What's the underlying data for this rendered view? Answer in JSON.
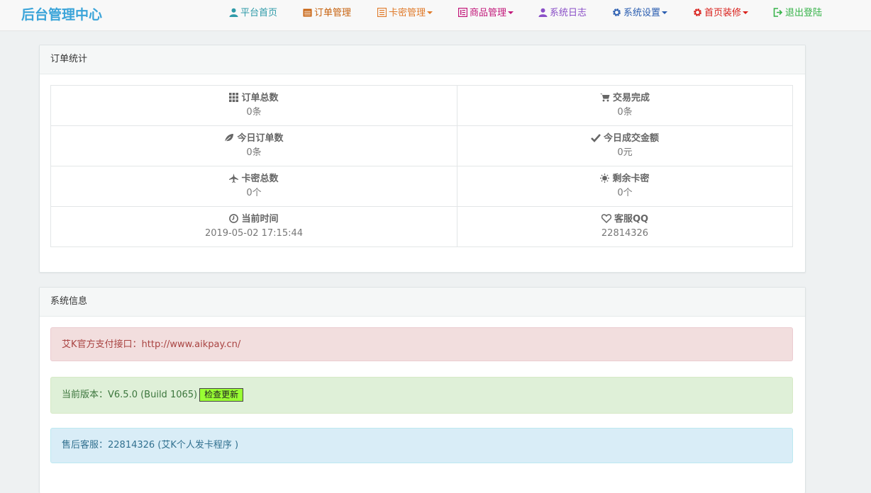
{
  "brand": "后台管理中心",
  "nav": [
    {
      "label": "平台首页",
      "color": "#2e9aa8",
      "icon": "user-icon",
      "caret": false
    },
    {
      "label": "订单管理",
      "color": "#c7620f",
      "icon": "calendar-icon",
      "caret": false
    },
    {
      "label": "卡密管理",
      "color": "#e07a2a",
      "icon": "list-icon",
      "caret": true
    },
    {
      "label": "商品管理",
      "color": "#c2187a",
      "icon": "book-icon",
      "caret": true
    },
    {
      "label": "系统日志",
      "color": "#8a4fc7",
      "icon": "user-icon",
      "caret": false
    },
    {
      "label": "系统设置",
      "color": "#2a5db0",
      "icon": "gear-icon",
      "caret": true
    },
    {
      "label": "首页装修",
      "color": "#d9201b",
      "icon": "gear-icon",
      "caret": true
    },
    {
      "label": "退出登陆",
      "color": "#37b34a",
      "icon": "logout-icon",
      "caret": false
    }
  ],
  "order_stats": {
    "title": "订单统计",
    "rows": [
      [
        {
          "label": "订单总数",
          "value": "0条",
          "icon": "grid-icon"
        },
        {
          "label": "交易完成",
          "value": "0条",
          "icon": "cart-icon"
        }
      ],
      [
        {
          "label": "今日订单数",
          "value": "0条",
          "icon": "leaf-icon"
        },
        {
          "label": "今日成交金额",
          "value": "0元",
          "icon": "check-icon"
        }
      ],
      [
        {
          "label": "卡密总数",
          "value": "0个",
          "icon": "plane-icon"
        },
        {
          "label": "剩余卡密",
          "value": "0个",
          "icon": "sun-icon"
        }
      ],
      [
        {
          "label": "当前时间",
          "value": "2019-05-02 17:15:44",
          "icon": "clock-icon"
        },
        {
          "label": "客服QQ",
          "value": "22814326",
          "icon": "heart-icon"
        }
      ]
    ]
  },
  "system_info": {
    "title": "系统信息",
    "api_text": "艾K官方支付接口：http://www.aikpay.cn/",
    "version_text": "当前版本：V6.5.0 (Build 1065)",
    "check_update_label": "检查更新",
    "support_text": "售后客服：22814326 (艾K个人发卡程序 )"
  }
}
